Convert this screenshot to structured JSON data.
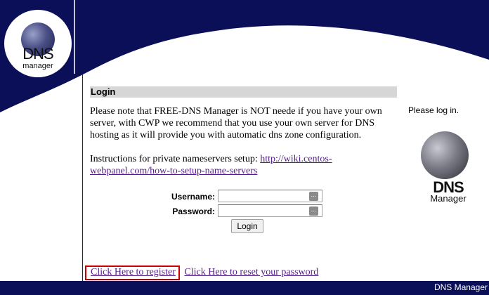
{
  "header": {
    "logo_dns": "DNS",
    "logo_manager": "manager"
  },
  "login": {
    "heading": "Login",
    "note": "Please note that FREE-DNS Manager is NOT neede if you have your own server, with CWP we recommend that you use your own server for DNS hosting as it will provide you with automatic dns zone configuration.",
    "instructions_prefix": "Instructions for private nameservers setup: ",
    "instructions_link": "http://wiki.centos-webpanel.com/how-to-setup-name-servers",
    "username_label": "Username:",
    "username_value": "",
    "password_label": "Password:",
    "password_value": "",
    "login_button": "Login"
  },
  "sidebar": {
    "note": "Please log in.",
    "logo_dns": "DNS",
    "logo_manager": "Manager"
  },
  "links": {
    "register": "Click Here to register",
    "reset_password": "Click Here to reset your password"
  },
  "footer": {
    "text": "DNS Manager"
  },
  "colors": {
    "navy": "#0b0f57",
    "highlight_border": "#cc0000",
    "link": "#551a8b"
  },
  "icons": {
    "field_icon": "keyboard-icon"
  }
}
